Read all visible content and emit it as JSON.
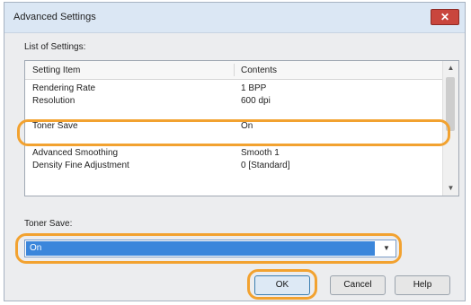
{
  "window": {
    "title": "Advanced Settings",
    "close_icon": "close-icon"
  },
  "list": {
    "label": "List of Settings:",
    "columns": [
      "Setting Item",
      "Contents"
    ],
    "rows": [
      {
        "item": "Rendering Rate",
        "contents": "1 BPP"
      },
      {
        "item": "Resolution",
        "contents": "600 dpi"
      },
      {
        "item": "Toner Save",
        "contents": "On"
      },
      {
        "item": "Advanced Smoothing",
        "contents": "Smooth 1"
      },
      {
        "item": "Density Fine Adjustment",
        "contents": "0 [Standard]"
      }
    ]
  },
  "toner_save": {
    "label": "Toner Save:",
    "value": "On"
  },
  "buttons": {
    "ok": "OK",
    "cancel": "Cancel",
    "help": "Help"
  },
  "colors": {
    "accent": "#f2a230",
    "selection": "#3b86db"
  }
}
